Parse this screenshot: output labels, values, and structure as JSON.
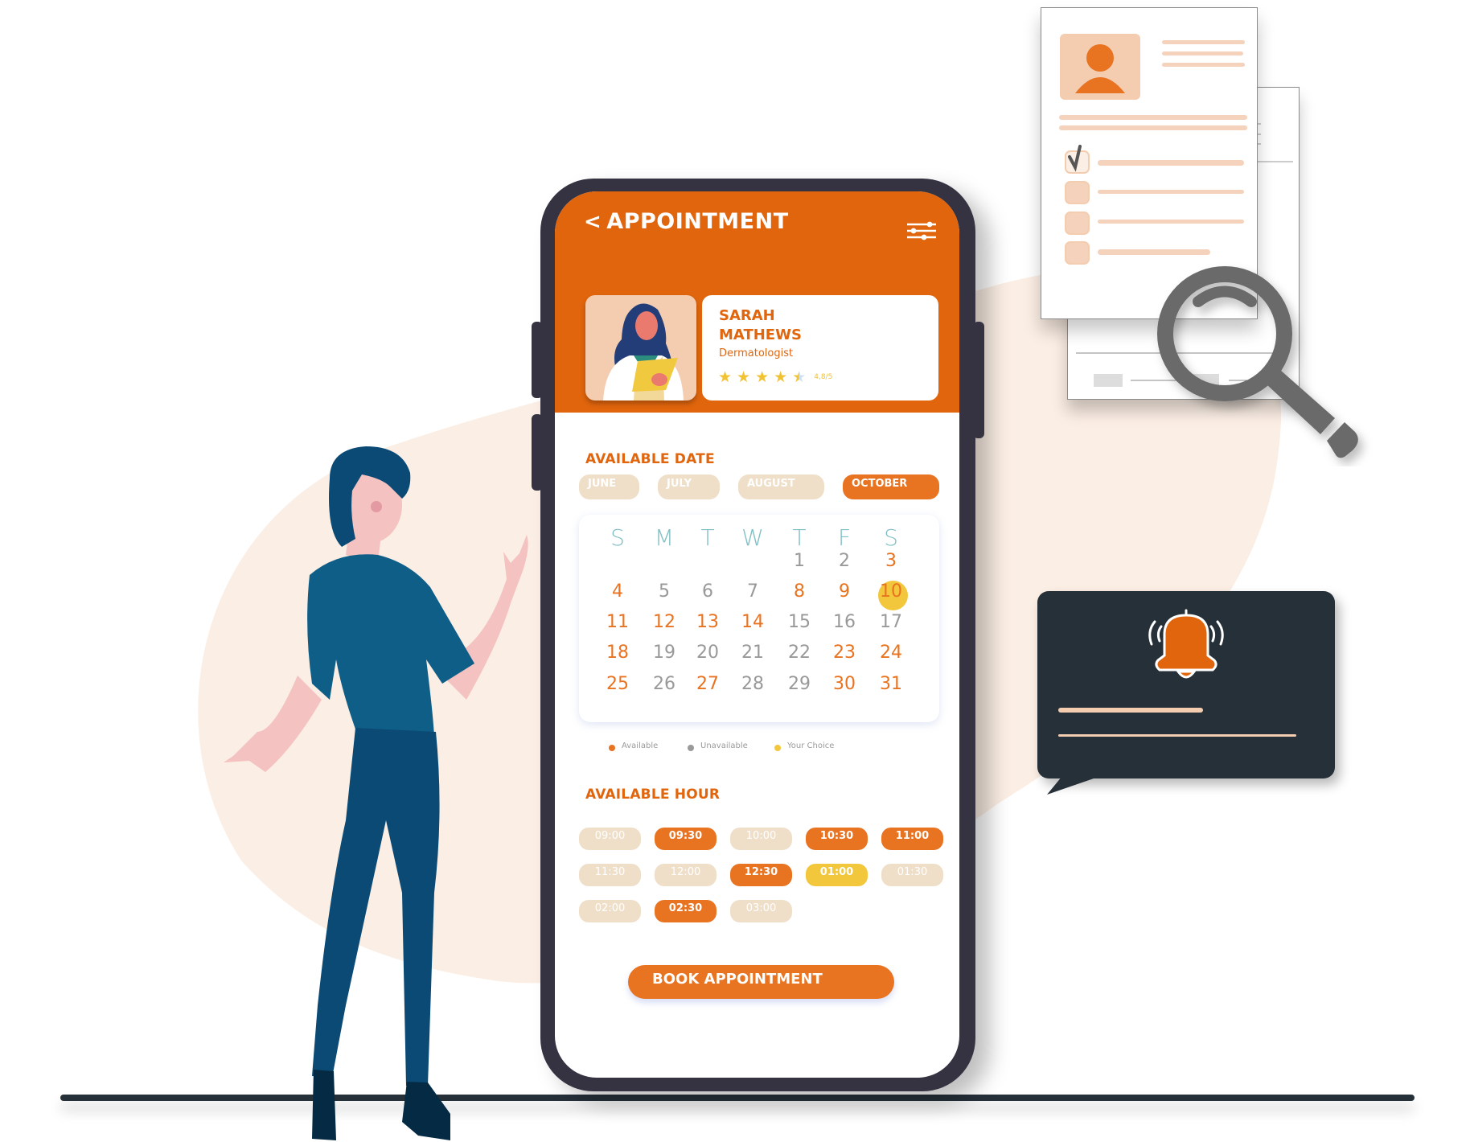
{
  "app": {
    "header": {
      "back_icon": "chevron-left-icon",
      "title": "APPOINTMENT",
      "filter_icon": "sliders-icon"
    },
    "doctor": {
      "name_line1": "SARAH",
      "name_line2": "MATHEWS",
      "specialty": "Dermatologist",
      "rating_stars": 4.5,
      "rating_text": "4,8/5"
    },
    "available_date": {
      "title": "AVAILABLE DATE",
      "months": [
        {
          "label": "JUNE",
          "active": false
        },
        {
          "label": "JULY",
          "active": false
        },
        {
          "label": "AUGUST",
          "active": false
        },
        {
          "label": "OCTOBER",
          "active": true
        }
      ],
      "weekdays": [
        "S",
        "M",
        "T",
        "W",
        "T",
        "F",
        "S"
      ],
      "start_weekday_index": 4,
      "days": [
        {
          "d": "1",
          "s": "unavailable"
        },
        {
          "d": "2",
          "s": "unavailable"
        },
        {
          "d": "3",
          "s": "available"
        },
        {
          "d": "4",
          "s": "available"
        },
        {
          "d": "5",
          "s": "unavailable"
        },
        {
          "d": "6",
          "s": "unavailable"
        },
        {
          "d": "7",
          "s": "unavailable"
        },
        {
          "d": "8",
          "s": "available"
        },
        {
          "d": "9",
          "s": "available"
        },
        {
          "d": "10",
          "s": "choice"
        },
        {
          "d": "11",
          "s": "available"
        },
        {
          "d": "12",
          "s": "available"
        },
        {
          "d": "13",
          "s": "available"
        },
        {
          "d": "14",
          "s": "available"
        },
        {
          "d": "15",
          "s": "unavailable"
        },
        {
          "d": "16",
          "s": "unavailable"
        },
        {
          "d": "17",
          "s": "unavailable"
        },
        {
          "d": "18",
          "s": "available"
        },
        {
          "d": "19",
          "s": "unavailable"
        },
        {
          "d": "20",
          "s": "unavailable"
        },
        {
          "d": "21",
          "s": "unavailable"
        },
        {
          "d": "22",
          "s": "unavailable"
        },
        {
          "d": "23",
          "s": "available"
        },
        {
          "d": "24",
          "s": "available"
        },
        {
          "d": "25",
          "s": "available"
        },
        {
          "d": "26",
          "s": "unavailable"
        },
        {
          "d": "27",
          "s": "available"
        },
        {
          "d": "28",
          "s": "unavailable"
        },
        {
          "d": "29",
          "s": "unavailable"
        },
        {
          "d": "30",
          "s": "available"
        },
        {
          "d": "31",
          "s": "available"
        }
      ],
      "legend": [
        {
          "label": "Available",
          "color": "#e87321"
        },
        {
          "label": "Unavailable",
          "color": "#9a9a9a"
        },
        {
          "label": "Your Choice",
          "color": "#f2c73c"
        }
      ]
    },
    "available_hour": {
      "title": "AVAILABLE HOUR",
      "slots": [
        {
          "time": "09:00",
          "s": "unavailable"
        },
        {
          "time": "09:30",
          "s": "available"
        },
        {
          "time": "10:00",
          "s": "unavailable"
        },
        {
          "time": "10:30",
          "s": "available"
        },
        {
          "time": "11:00",
          "s": "available"
        },
        {
          "time": "11:30",
          "s": "unavailable"
        },
        {
          "time": "12:00",
          "s": "unavailable"
        },
        {
          "time": "12:30",
          "s": "available"
        },
        {
          "time": "01:00",
          "s": "choice"
        },
        {
          "time": "01:30",
          "s": "unavailable"
        },
        {
          "time": "02:00",
          "s": "unavailable"
        },
        {
          "time": "02:30",
          "s": "available"
        },
        {
          "time": "03:00",
          "s": "unavailable"
        }
      ]
    },
    "book_button": "BOOK APPOINTMENT"
  },
  "colors": {
    "brand_orange": "#e0650d",
    "accent_orange": "#e87321",
    "choice_yellow": "#f2c73c",
    "unavailable_beige": "#f0dfc8",
    "phone_frame": "#353241",
    "dark_card": "#263039",
    "figure_blue": "#0f5e88"
  },
  "illustration": {
    "profile_document_icon": "resume-checklist-icon",
    "magnifier_icon": "magnifying-glass-icon",
    "notification_icon": "ringing-bell-icon"
  }
}
